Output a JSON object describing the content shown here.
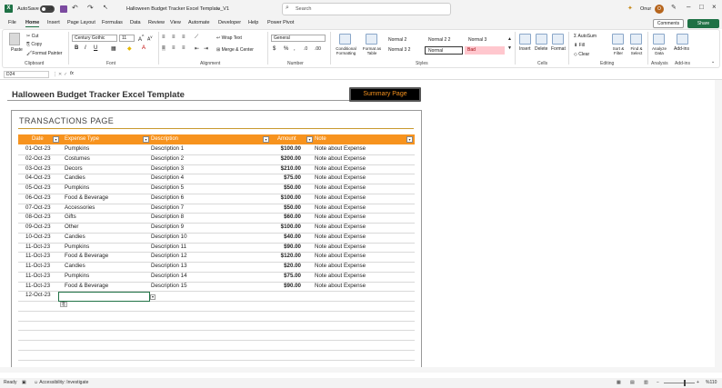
{
  "titlebar": {
    "autosave_label": "AutoSave",
    "autosave_state": "Off",
    "doc_title": "Halloween Budget Tracker Excel Template_V1",
    "search_placeholder": "Search",
    "user_name": "Onur",
    "user_initial": "O"
  },
  "menu": {
    "tabs": [
      "File",
      "Home",
      "Insert",
      "Page Layout",
      "Formulas",
      "Data",
      "Review",
      "View",
      "Automate",
      "Developer",
      "Help",
      "Power Pivot"
    ],
    "active_tab": "Home",
    "comments_label": "Comments",
    "share_label": "Share"
  },
  "ribbon": {
    "clipboard": {
      "paste": "Paste",
      "cut": "Cut",
      "copy": "Copy",
      "format_painter": "Format Painter",
      "label": "Clipboard"
    },
    "font": {
      "name": "Century Gothic",
      "size": "11",
      "label": "Font"
    },
    "alignment": {
      "wrap_text": "Wrap Text",
      "merge_center": "Merge & Center",
      "label": "Alignment"
    },
    "number": {
      "format": "General",
      "label": "Number"
    },
    "styles": {
      "conditional": "Conditional Formatting",
      "format_as_table": "Format as Table",
      "cells": [
        "Normal 2",
        "Normal 2 2",
        "Normal 3",
        "Normal 3 2",
        "Normal",
        "Bad"
      ],
      "label": "Styles"
    },
    "cells_group": {
      "insert": "Insert",
      "delete": "Delete",
      "format": "Format",
      "label": "Cells"
    },
    "editing": {
      "autosum": "AutoSum",
      "fill": "Fill",
      "clear": "Clear",
      "sort_filter": "Sort & Filter",
      "find_select": "Find & Select",
      "label": "Editing"
    },
    "analysis": {
      "analyze_data": "Analyze Data",
      "label": "Analysis"
    },
    "addins": {
      "addins": "Add-ins",
      "label": "Add-ins"
    }
  },
  "formula_bar": {
    "cell_ref": "D24",
    "fx": "fx"
  },
  "sheet": {
    "title": "Halloween Budget Tracker Excel Template",
    "summary_button": "Summary Page",
    "section_title": "TRANSACTIONS PAGE",
    "headers": [
      "Date",
      "Expense Type",
      "Description",
      "Amount",
      "Note"
    ],
    "rows": [
      {
        "date": "01-Oct-23",
        "type": "Pumpkins",
        "desc": "Description 1",
        "amount": "$100.00",
        "note": "Note about Expense"
      },
      {
        "date": "02-Oct-23",
        "type": "Costumes",
        "desc": "Description 2",
        "amount": "$200.00",
        "note": "Note about Expense"
      },
      {
        "date": "03-Oct-23",
        "type": "Decors",
        "desc": "Description 3",
        "amount": "$210.00",
        "note": "Note about Expense"
      },
      {
        "date": "04-Oct-23",
        "type": "Candies",
        "desc": "Description 4",
        "amount": "$75.00",
        "note": "Note about Expense"
      },
      {
        "date": "05-Oct-23",
        "type": "Pumpkins",
        "desc": "Description 5",
        "amount": "$50.00",
        "note": "Note about Expense"
      },
      {
        "date": "06-Oct-23",
        "type": "Food & Beverage",
        "desc": "Description 6",
        "amount": "$100.00",
        "note": "Note about Expense"
      },
      {
        "date": "07-Oct-23",
        "type": "Accessories",
        "desc": "Description 7",
        "amount": "$50.00",
        "note": "Note about Expense"
      },
      {
        "date": "08-Oct-23",
        "type": "Gifts",
        "desc": "Description 8",
        "amount": "$60.00",
        "note": "Note about Expense"
      },
      {
        "date": "09-Oct-23",
        "type": "Other",
        "desc": "Description 9",
        "amount": "$100.00",
        "note": "Note about Expense"
      },
      {
        "date": "10-Oct-23",
        "type": "Candies",
        "desc": "Description 10",
        "amount": "$40.00",
        "note": "Note about Expense"
      },
      {
        "date": "11-Oct-23",
        "type": "Pumpkins",
        "desc": "Description 11",
        "amount": "$90.00",
        "note": "Note about Expense"
      },
      {
        "date": "11-Oct-23",
        "type": "Food & Beverage",
        "desc": "Description 12",
        "amount": "$120.00",
        "note": "Note about Expense"
      },
      {
        "date": "11-Oct-23",
        "type": "Candies",
        "desc": "Description 13",
        "amount": "$20.00",
        "note": "Note about Expense"
      },
      {
        "date": "11-Oct-23",
        "type": "Pumpkins",
        "desc": "Description 14",
        "amount": "$75.00",
        "note": "Note about Expense"
      },
      {
        "date": "11-Oct-23",
        "type": "Food & Beverage",
        "desc": "Description 15",
        "amount": "$90.00",
        "note": "Note about Expense"
      },
      {
        "date": "12-Oct-23",
        "type": "",
        "desc": "",
        "amount": "",
        "note": ""
      }
    ]
  },
  "statusbar": {
    "ready": "Ready",
    "accessibility": "Accessibility: Investigate",
    "zoom": "%110"
  },
  "colors": {
    "accent_orange": "#f7931e",
    "excel_green": "#217346",
    "summary_bg": "#000000"
  }
}
